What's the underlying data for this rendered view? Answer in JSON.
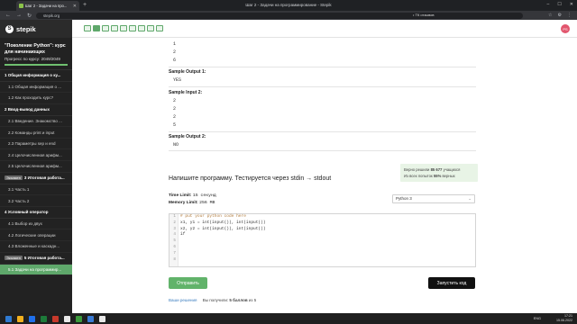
{
  "browser": {
    "tab_title": "Шаг 2 - Задачи на про...",
    "window_title": "Шаг 2 - Задачи на программирование - Stepik",
    "url": "stepik.org",
    "ext_badge": "• ТК отзывов"
  },
  "brand": {
    "name": "stepik"
  },
  "user": {
    "initials": "PS"
  },
  "step_nav": {
    "count": 9,
    "active_index": 1
  },
  "course": {
    "title": "\"Поколение Python\": курс для начинающих",
    "progress_label": "Прогресс по курсу:",
    "progress_value": "2049/2049",
    "progress_fraction": 1.0
  },
  "sidebar": {
    "items": [
      {
        "type": "module",
        "label": "1  Общая информация о ку..."
      },
      {
        "type": "lesson",
        "label": "1.1  Общая информация о ..."
      },
      {
        "type": "lesson",
        "label": "1.2  Как проходить курс?"
      },
      {
        "type": "module",
        "label": "2  Ввод-вывод данных"
      },
      {
        "type": "lesson",
        "label": "2.1  Введение. Знакомство ..."
      },
      {
        "type": "lesson",
        "label": "2.2  Команды print и input"
      },
      {
        "type": "lesson",
        "label": "2.3  Параметры sep и end"
      },
      {
        "type": "lesson",
        "label": "2.4  Целочисленная арифм..."
      },
      {
        "type": "lesson",
        "label": "2.5  Целочисленная арифм..."
      },
      {
        "type": "module",
        "badge": "Экзамен",
        "label": "3  Итоговая работа..."
      },
      {
        "type": "lesson",
        "label": "3.1  Часть 1"
      },
      {
        "type": "lesson",
        "label": "3.2  Часть 2"
      },
      {
        "type": "module",
        "label": "4  Условный оператор"
      },
      {
        "type": "lesson",
        "label": "4.1  Выбор из двух"
      },
      {
        "type": "lesson",
        "label": "4.2  Логические операции"
      },
      {
        "type": "lesson",
        "label": "4.3  Вложенные и каскадн..."
      },
      {
        "type": "module",
        "badge": "Экзамен",
        "label": "5  Итоговая работа..."
      },
      {
        "type": "lesson",
        "label": "5.1  Задачи на программир...",
        "active": true
      }
    ]
  },
  "samples": {
    "top_lines": [
      "1",
      "2",
      "6"
    ],
    "output1_title": "Sample Output 1:",
    "output1_value": "YES",
    "input2_title": "Sample Input 2:",
    "input2_lines": [
      "2",
      "2",
      "2",
      "5"
    ],
    "output2_title": "Sample Output 2:",
    "output2_value": "NO"
  },
  "stats": {
    "line1_prefix": "Верно решили",
    "line1_count": "85 677",
    "line1_suffix": "учащихся",
    "line2_prefix": "Из всех попыток",
    "line2_pct": "55%",
    "line2_suffix": "верных"
  },
  "task": {
    "title": "Напишите программу. Тестируется через stdin → stdout",
    "time_label": "Time Limit:",
    "time_value": "15 секунд",
    "memory_label": "Memory Limit:",
    "memory_value": "256 MB",
    "language": "Python 3"
  },
  "editor": {
    "line_numbers": [
      "1",
      "2",
      "3",
      "4",
      "5",
      "6",
      "7",
      "8"
    ],
    "lines": [
      "# put your python code here",
      "x1, y1 = int(input()), int(input())",
      "x2, y2 = int(input()), int(input())",
      "if ",
      "",
      "",
      "",
      ""
    ]
  },
  "actions": {
    "submit": "Отправить",
    "run": "Запустить код"
  },
  "result": {
    "link": "Ваши решения",
    "prefix": "Вы получили:",
    "score": "5 баллов",
    "suffix": "из 5"
  },
  "taskbar": {
    "lang": "ENG",
    "time": "17:21",
    "date": "15.06.2022",
    "app_colors": [
      "#2f7ad1",
      "#f2b01e",
      "#1f6feb",
      "#1d7b3a",
      "#c7392b",
      "#e8e8e8",
      "#3c9a3c",
      "#3a7bd5",
      "#e8e8e8"
    ]
  }
}
